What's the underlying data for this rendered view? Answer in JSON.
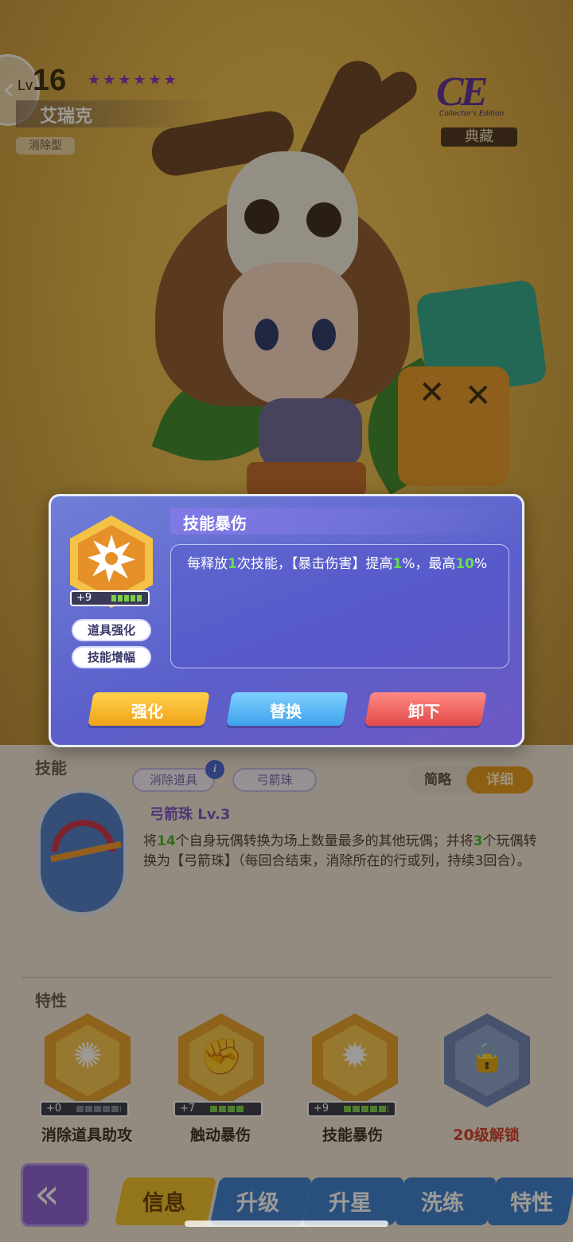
{
  "hero": {
    "level_prefix": "Lv",
    "level": "16",
    "stars": "★★★★★★",
    "name": "艾瑞克",
    "type": "消除型",
    "edition_logo": "CE",
    "edition_logo_sub": "Collector's Edition",
    "edition_label": "典藏"
  },
  "skill_section": {
    "title": "技能",
    "filters": [
      "消除道具",
      "弓箭珠"
    ],
    "info_icon": "i",
    "toggle": {
      "simple": "简略",
      "detail": "详细",
      "selected": "详细"
    },
    "skill_name": "弓箭珠 Lv.3",
    "skill_desc_parts": {
      "a": "将",
      "b": "14",
      "c": "个自身玩偶转换为场上数量最多的其他玩偶；并将",
      "d": "3",
      "e": "个玩偶转换为【弓箭珠】（每回合结束，消除所在的行或列，持续3回合）。"
    }
  },
  "traits_section": {
    "title": "特性",
    "traits": [
      {
        "label": "消除道具助攻",
        "level": "+0",
        "filled_pips": 0,
        "locked": false
      },
      {
        "label": "触动暴伤",
        "level": "+7",
        "filled_pips": 4,
        "locked": false
      },
      {
        "label": "技能暴伤",
        "level": "+9",
        "filled_pips": 5,
        "locked": false
      },
      {
        "label": "20级解锁",
        "locked": true
      }
    ]
  },
  "nav": {
    "back_icon": "back-arrow-icon",
    "tabs": [
      "信息",
      "升级",
      "升星",
      "洗练",
      "特性"
    ],
    "active_tab": "信息"
  },
  "modal": {
    "title": "技能暴伤",
    "icon": "burst-icon",
    "level": "+9",
    "level_pips_filled": 5,
    "tags": [
      "道具强化",
      "技能增幅"
    ],
    "desc_parts": {
      "a": "每释放",
      "b": "1",
      "c": "次技能，【暴击伤害】提高",
      "d": "1",
      "e": "%，最高",
      "f": "10",
      "g": "%"
    },
    "buttons": {
      "enhance": "强化",
      "replace": "替换",
      "unequip": "卸下"
    },
    "colors": {
      "enhance": "#f0a21a",
      "replace": "#3ea2ec",
      "unequip": "#e24a48",
      "highlight": "#66e04a"
    }
  }
}
